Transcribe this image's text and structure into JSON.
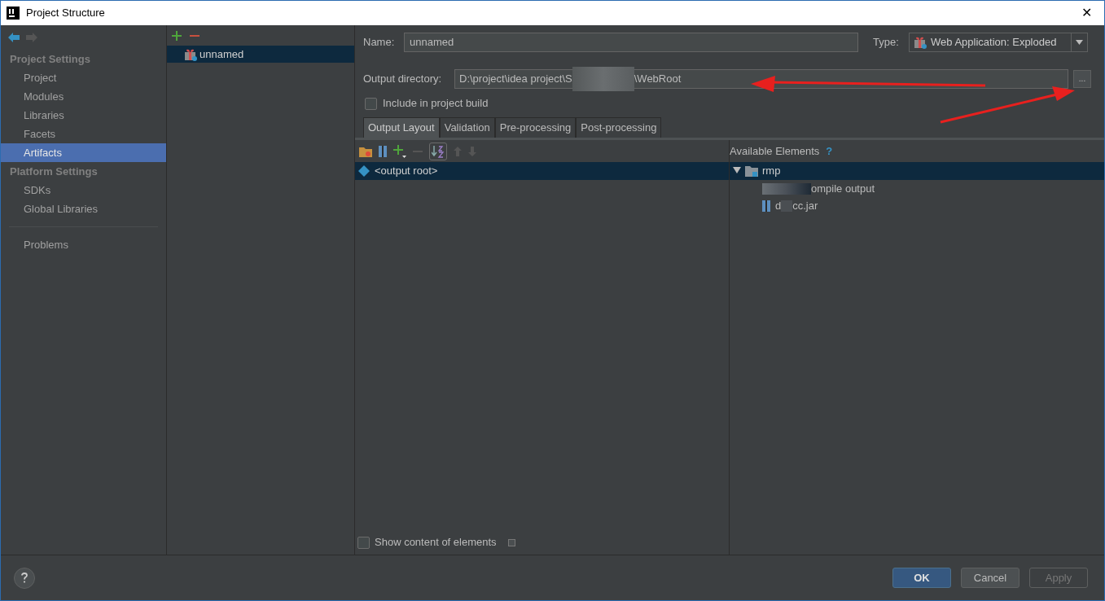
{
  "window": {
    "title": "Project Structure",
    "close": "✕"
  },
  "sidebar": {
    "sections": [
      {
        "title": "Project Settings",
        "items": [
          {
            "label": "Project",
            "selected": false
          },
          {
            "label": "Modules",
            "selected": false
          },
          {
            "label": "Libraries",
            "selected": false
          },
          {
            "label": "Facets",
            "selected": false
          },
          {
            "label": "Artifacts",
            "selected": true
          }
        ]
      },
      {
        "title": "Platform Settings",
        "items": [
          {
            "label": "SDKs",
            "selected": false
          },
          {
            "label": "Global Libraries",
            "selected": false
          }
        ]
      }
    ],
    "problems": "Problems"
  },
  "artifacts": [
    {
      "label": "unnamed",
      "selected": true
    }
  ],
  "name": {
    "label": "Name:",
    "value": "unnamed"
  },
  "type": {
    "label": "Type:",
    "value": "Web Application: Exploded"
  },
  "output_directory": {
    "label": "Output directory:",
    "value_start": "D:\\project\\idea project\\S",
    "value_end": "\\WebRoot",
    "browse": "..."
  },
  "include_in_build": {
    "label": "Include in project build",
    "checked": false
  },
  "tabs": [
    {
      "label": "Output Layout",
      "selected": true
    },
    {
      "label": "Validation",
      "selected": false
    },
    {
      "label": "Pre-processing",
      "selected": false
    },
    {
      "label": "Post-processing",
      "selected": false
    }
  ],
  "layout_tree": [
    {
      "label": "<output root>",
      "selected": true
    }
  ],
  "available": {
    "title": "Available Elements",
    "help": "?",
    "tree": [
      {
        "label": "rmp",
        "expanded": true,
        "selected": true,
        "children": [
          {
            "kind": "module_output",
            "label": "ompile output"
          },
          {
            "kind": "jar",
            "label_start": "d",
            "label_end": "cc.jar"
          }
        ]
      }
    ]
  },
  "show_content": {
    "label": "Show content of elements",
    "checked": false
  },
  "buttons": [
    {
      "label": "OK",
      "kind": "default"
    },
    {
      "label": "Cancel",
      "kind": "normal"
    },
    {
      "label": "Apply",
      "kind": "disabled"
    }
  ]
}
